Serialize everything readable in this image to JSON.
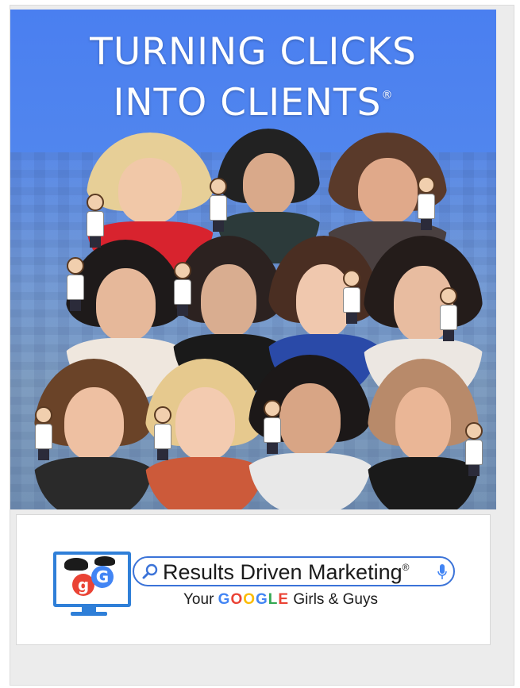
{
  "headline": {
    "line1": "TURNING CLICKS",
    "line2": "INTO CLIENTS",
    "mark": "®"
  },
  "brand": {
    "name": "Results Driven Marketing",
    "mark": "®",
    "monogram_1": "g",
    "monogram_2": "G"
  },
  "tagline": {
    "prefix": "Your",
    "google_letters": [
      {
        "ch": "G",
        "color": "#4285F4"
      },
      {
        "ch": "O",
        "color": "#EA4335"
      },
      {
        "ch": "O",
        "color": "#FBBC05"
      },
      {
        "ch": "G",
        "color": "#4285F4"
      },
      {
        "ch": "L",
        "color": "#34A853"
      },
      {
        "ch": "E",
        "color": "#EA4335"
      }
    ],
    "suffix": "Girls & Guys"
  },
  "colors": {
    "poster_blue": "#4a7ff0",
    "accent_blue": "#2f7fd8",
    "google_red": "#EA4335",
    "google_blue": "#4285F4"
  },
  "icons": [
    "search-icon",
    "microphone-icon",
    "monitor-icon"
  ]
}
